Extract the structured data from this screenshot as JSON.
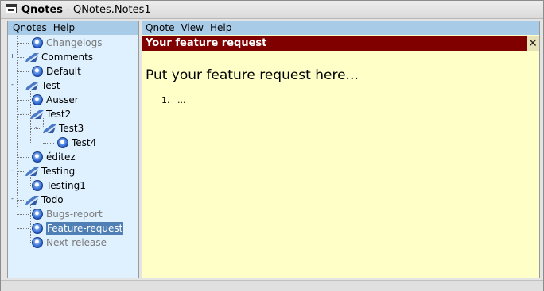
{
  "window": {
    "app_name": "Qnotes",
    "title_suffix": " - QNotes.Notes1"
  },
  "left_menu": {
    "items": [
      "Qnotes",
      "Help"
    ]
  },
  "right_menu": {
    "items": [
      "Qnote",
      "View",
      "Help"
    ]
  },
  "tree": {
    "nodes": [
      {
        "label": "Changelogs",
        "icon": "globe-icon",
        "dim": true
      },
      {
        "label": "Comments",
        "icon": "book-icon",
        "expander": "+"
      },
      {
        "label": "Default",
        "icon": "globe-icon"
      },
      {
        "label": "Test",
        "icon": "book-icon",
        "expander": "-"
      },
      {
        "label": "Ausser",
        "icon": "globe-icon"
      },
      {
        "label": "Test2",
        "icon": "book-icon",
        "expander": "-"
      },
      {
        "label": "Test3",
        "icon": "book-icon",
        "expander": "-"
      },
      {
        "label": "Test4",
        "icon": "globe-icon"
      },
      {
        "label": "éditez",
        "icon": "globe-icon"
      },
      {
        "label": "Testing",
        "icon": "book-icon",
        "expander": "-"
      },
      {
        "label": "Testing1",
        "icon": "globe-icon"
      },
      {
        "label": "Todo",
        "icon": "book-icon",
        "expander": "-"
      },
      {
        "label": "Bugs-report",
        "icon": "globe-icon",
        "dim": true
      },
      {
        "label": "Feature-request",
        "icon": "globe-icon",
        "selected": true
      },
      {
        "label": "Next-release",
        "icon": "globe-icon",
        "dim": true
      }
    ]
  },
  "note": {
    "title": "Your feature request",
    "close_symbol": "✕",
    "heading": "Put your feature request here...",
    "list_number": "1.",
    "list_text": "..."
  },
  "colors": {
    "header_bg": "#800000",
    "note_bg": "#ffffc8",
    "tree_bg": "#dff0ff",
    "menu_bg": "#a8cce8",
    "selection": "#4f7fb5"
  }
}
